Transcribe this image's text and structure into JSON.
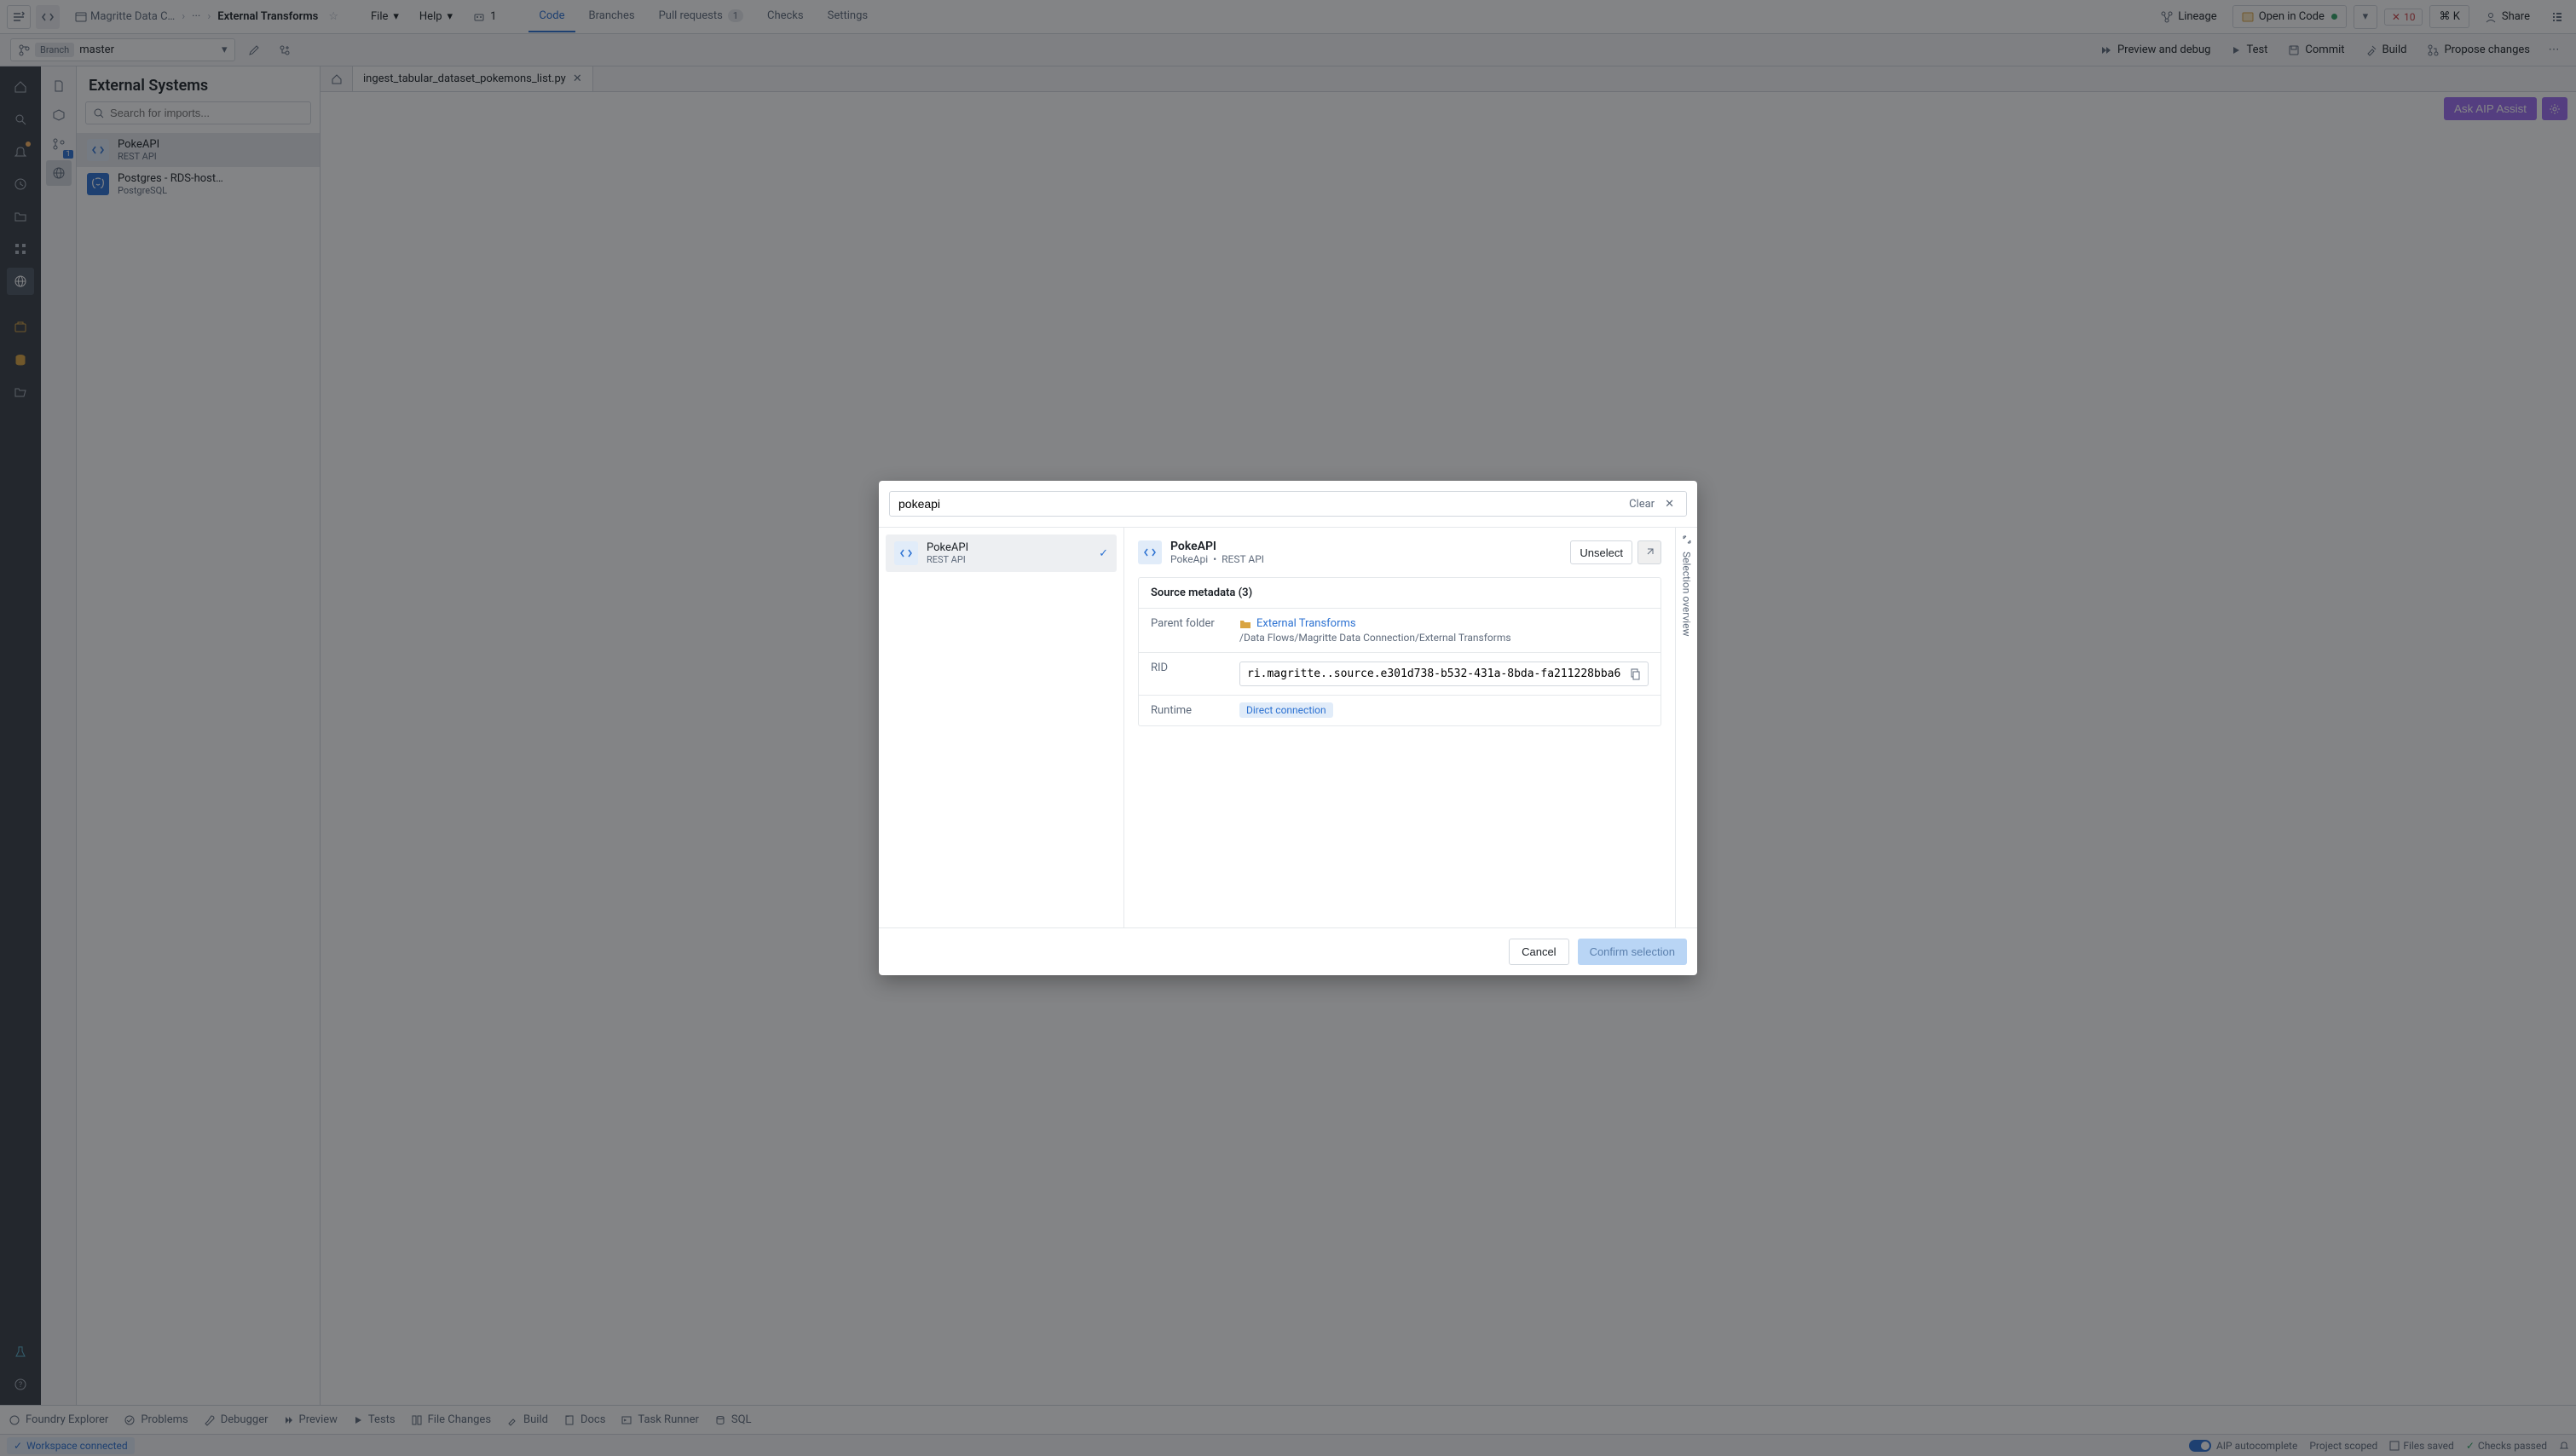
{
  "breadcrumb": {
    "project": "Magritte Data C…",
    "ellipsis": "···",
    "page": "External Transforms"
  },
  "menus": {
    "file": "File",
    "help": "Help",
    "agents": "1"
  },
  "tabs": {
    "code": "Code",
    "branches": "Branches",
    "pull_requests": "Pull requests",
    "pr_count": "1",
    "checks": "Checks",
    "settings": "Settings"
  },
  "topright": {
    "lineage": "Lineage",
    "open_in_code": "Open in Code",
    "errors": "10",
    "shortcut": "⌘  K",
    "share": "Share"
  },
  "branch": {
    "label": "Branch",
    "name": "master"
  },
  "branch_actions": {
    "preview_debug": "Preview and debug",
    "test": "Test",
    "commit": "Commit",
    "build": "Build",
    "propose": "Propose changes"
  },
  "left_panel": {
    "title": "External Systems",
    "search_placeholder": "Search for imports...",
    "items": [
      {
        "name": "PokeAPI",
        "sub": "REST API",
        "kind": "api"
      },
      {
        "name": "Postgres - RDS-host…",
        "sub": "PostgreSQL",
        "kind": "pg"
      }
    ]
  },
  "file_tab": {
    "name": "ingest_tabular_dataset_pokemons_list.py"
  },
  "aip": {
    "assist": "Ask AIP Assist"
  },
  "bottom": {
    "explorer": "Foundry Explorer",
    "problems": "Problems",
    "debugger": "Debugger",
    "preview": "Preview",
    "tests": "Tests",
    "file_changes": "File Changes",
    "build": "Build",
    "docs": "Docs",
    "task_runner": "Task Runner",
    "sql": "SQL"
  },
  "status": {
    "workspace": "Workspace connected",
    "autocomplete": "AIP autocomplete",
    "scope": "Project scoped",
    "files_saved": "Files saved",
    "checks": "Checks passed"
  },
  "modal": {
    "search_value": "pokeapi",
    "clear": "Clear",
    "result": {
      "name": "PokeAPI",
      "sub": "REST API"
    },
    "detail": {
      "title": "PokeAPI",
      "sub_left": "PokeApi",
      "sub_right": "REST API",
      "unselect": "Unselect",
      "card_title": "Source metadata (3)",
      "parent_label": "Parent folder",
      "parent_link": "External Transforms",
      "parent_path": "/Data Flows/Magritte Data Connection/External Transforms",
      "rid_label": "RID",
      "rid_value": "ri.magritte..source.e301d738-b532-431a-8bda-fa211228bba6",
      "runtime_label": "Runtime",
      "runtime_value": "Direct connection"
    },
    "side_label": "Selection overview",
    "cancel": "Cancel",
    "confirm": "Confirm selection"
  }
}
